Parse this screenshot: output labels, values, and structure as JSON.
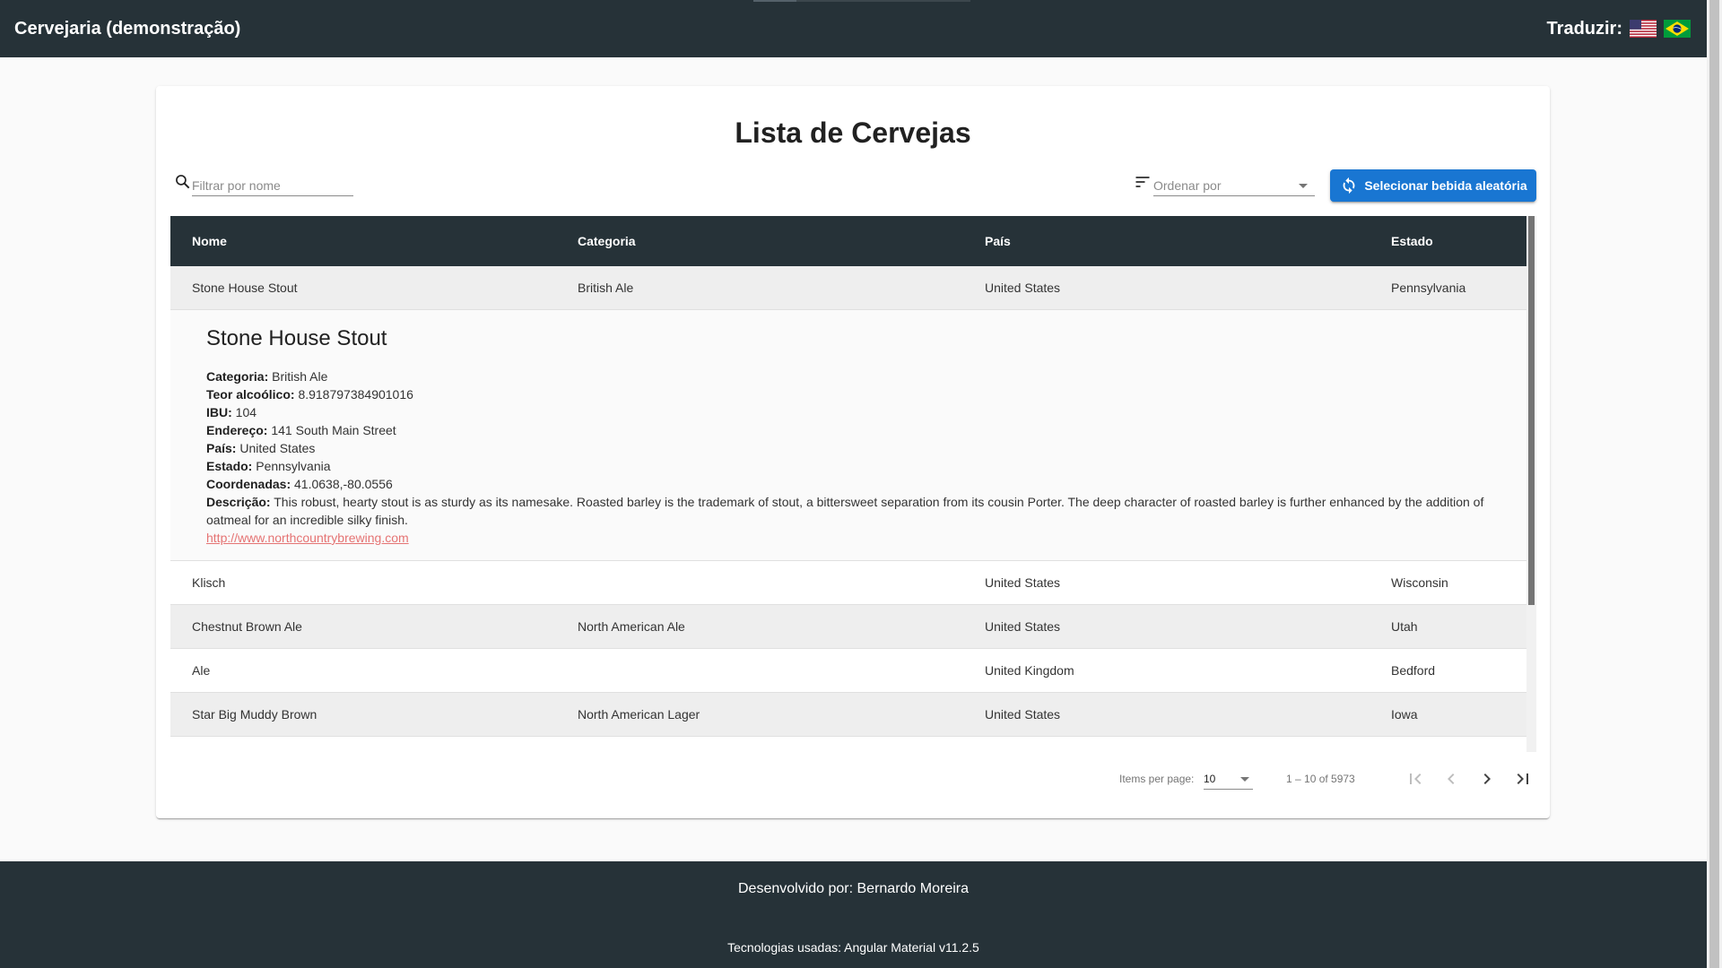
{
  "app": {
    "title": "Cervejaria (demonstração)",
    "translate_label": "Traduzir:",
    "flags": [
      "us-flag",
      "brazil-flag"
    ]
  },
  "main": {
    "heading": "Lista de Cervejas",
    "search": {
      "placeholder": "Filtrar por nome",
      "value": ""
    },
    "sort": {
      "placeholder": "Ordenar por"
    },
    "random_button": "Selecionar bebida aleatória"
  },
  "table": {
    "columns": [
      "Nome",
      "Categoria",
      "País",
      "Estado"
    ],
    "rows": [
      {
        "nome": "Stone House Stout",
        "categoria": "British Ale",
        "pais": "United States",
        "estado": "Pennsylvania"
      },
      {
        "nome": "Klisch",
        "categoria": "",
        "pais": "United States",
        "estado": "Wisconsin"
      },
      {
        "nome": "Chestnut Brown Ale",
        "categoria": "North American Ale",
        "pais": "United States",
        "estado": "Utah"
      },
      {
        "nome": "Ale",
        "categoria": "",
        "pais": "United Kingdom",
        "estado": "Bedford"
      },
      {
        "nome": "Star Big Muddy Brown",
        "categoria": "North American Lager",
        "pais": "United States",
        "estado": "Iowa"
      }
    ],
    "expanded": {
      "title": "Stone House Stout",
      "fields": [
        {
          "label": "Categoria:",
          "value": "British Ale"
        },
        {
          "label": "Teor alcoólico:",
          "value": "8.918797384901016"
        },
        {
          "label": "IBU:",
          "value": "104"
        },
        {
          "label": "Endereço:",
          "value": "141 South Main Street"
        },
        {
          "label": "País:",
          "value": "United States"
        },
        {
          "label": "Estado:",
          "value": "Pennsylvania"
        },
        {
          "label": "Coordenadas:",
          "value": "41.0638,-80.0556"
        },
        {
          "label": "Descrição:",
          "value": "This robust, hearty stout is as sturdy as its namesake. Roasted barley is the trademark of stout, a bittersweet separation from its cousin Porter. The deep character of roasted barley is further enhanced by the addition of oatmeal for an incredible silky finish."
        }
      ],
      "link": "http://www.northcountrybrewing.com"
    }
  },
  "paginator": {
    "items_per_page_label": "Items per page:",
    "items_per_page": "10",
    "range": "1 – 10 of 5973"
  },
  "footer": {
    "developer": "Desenvolvido por: Bernardo Moreira",
    "technologies": "Tecnologias usadas: Angular Material v11.2.5"
  },
  "colors": {
    "toolbar": "#263238",
    "accent": "#1976d2",
    "link": "#e57373"
  }
}
